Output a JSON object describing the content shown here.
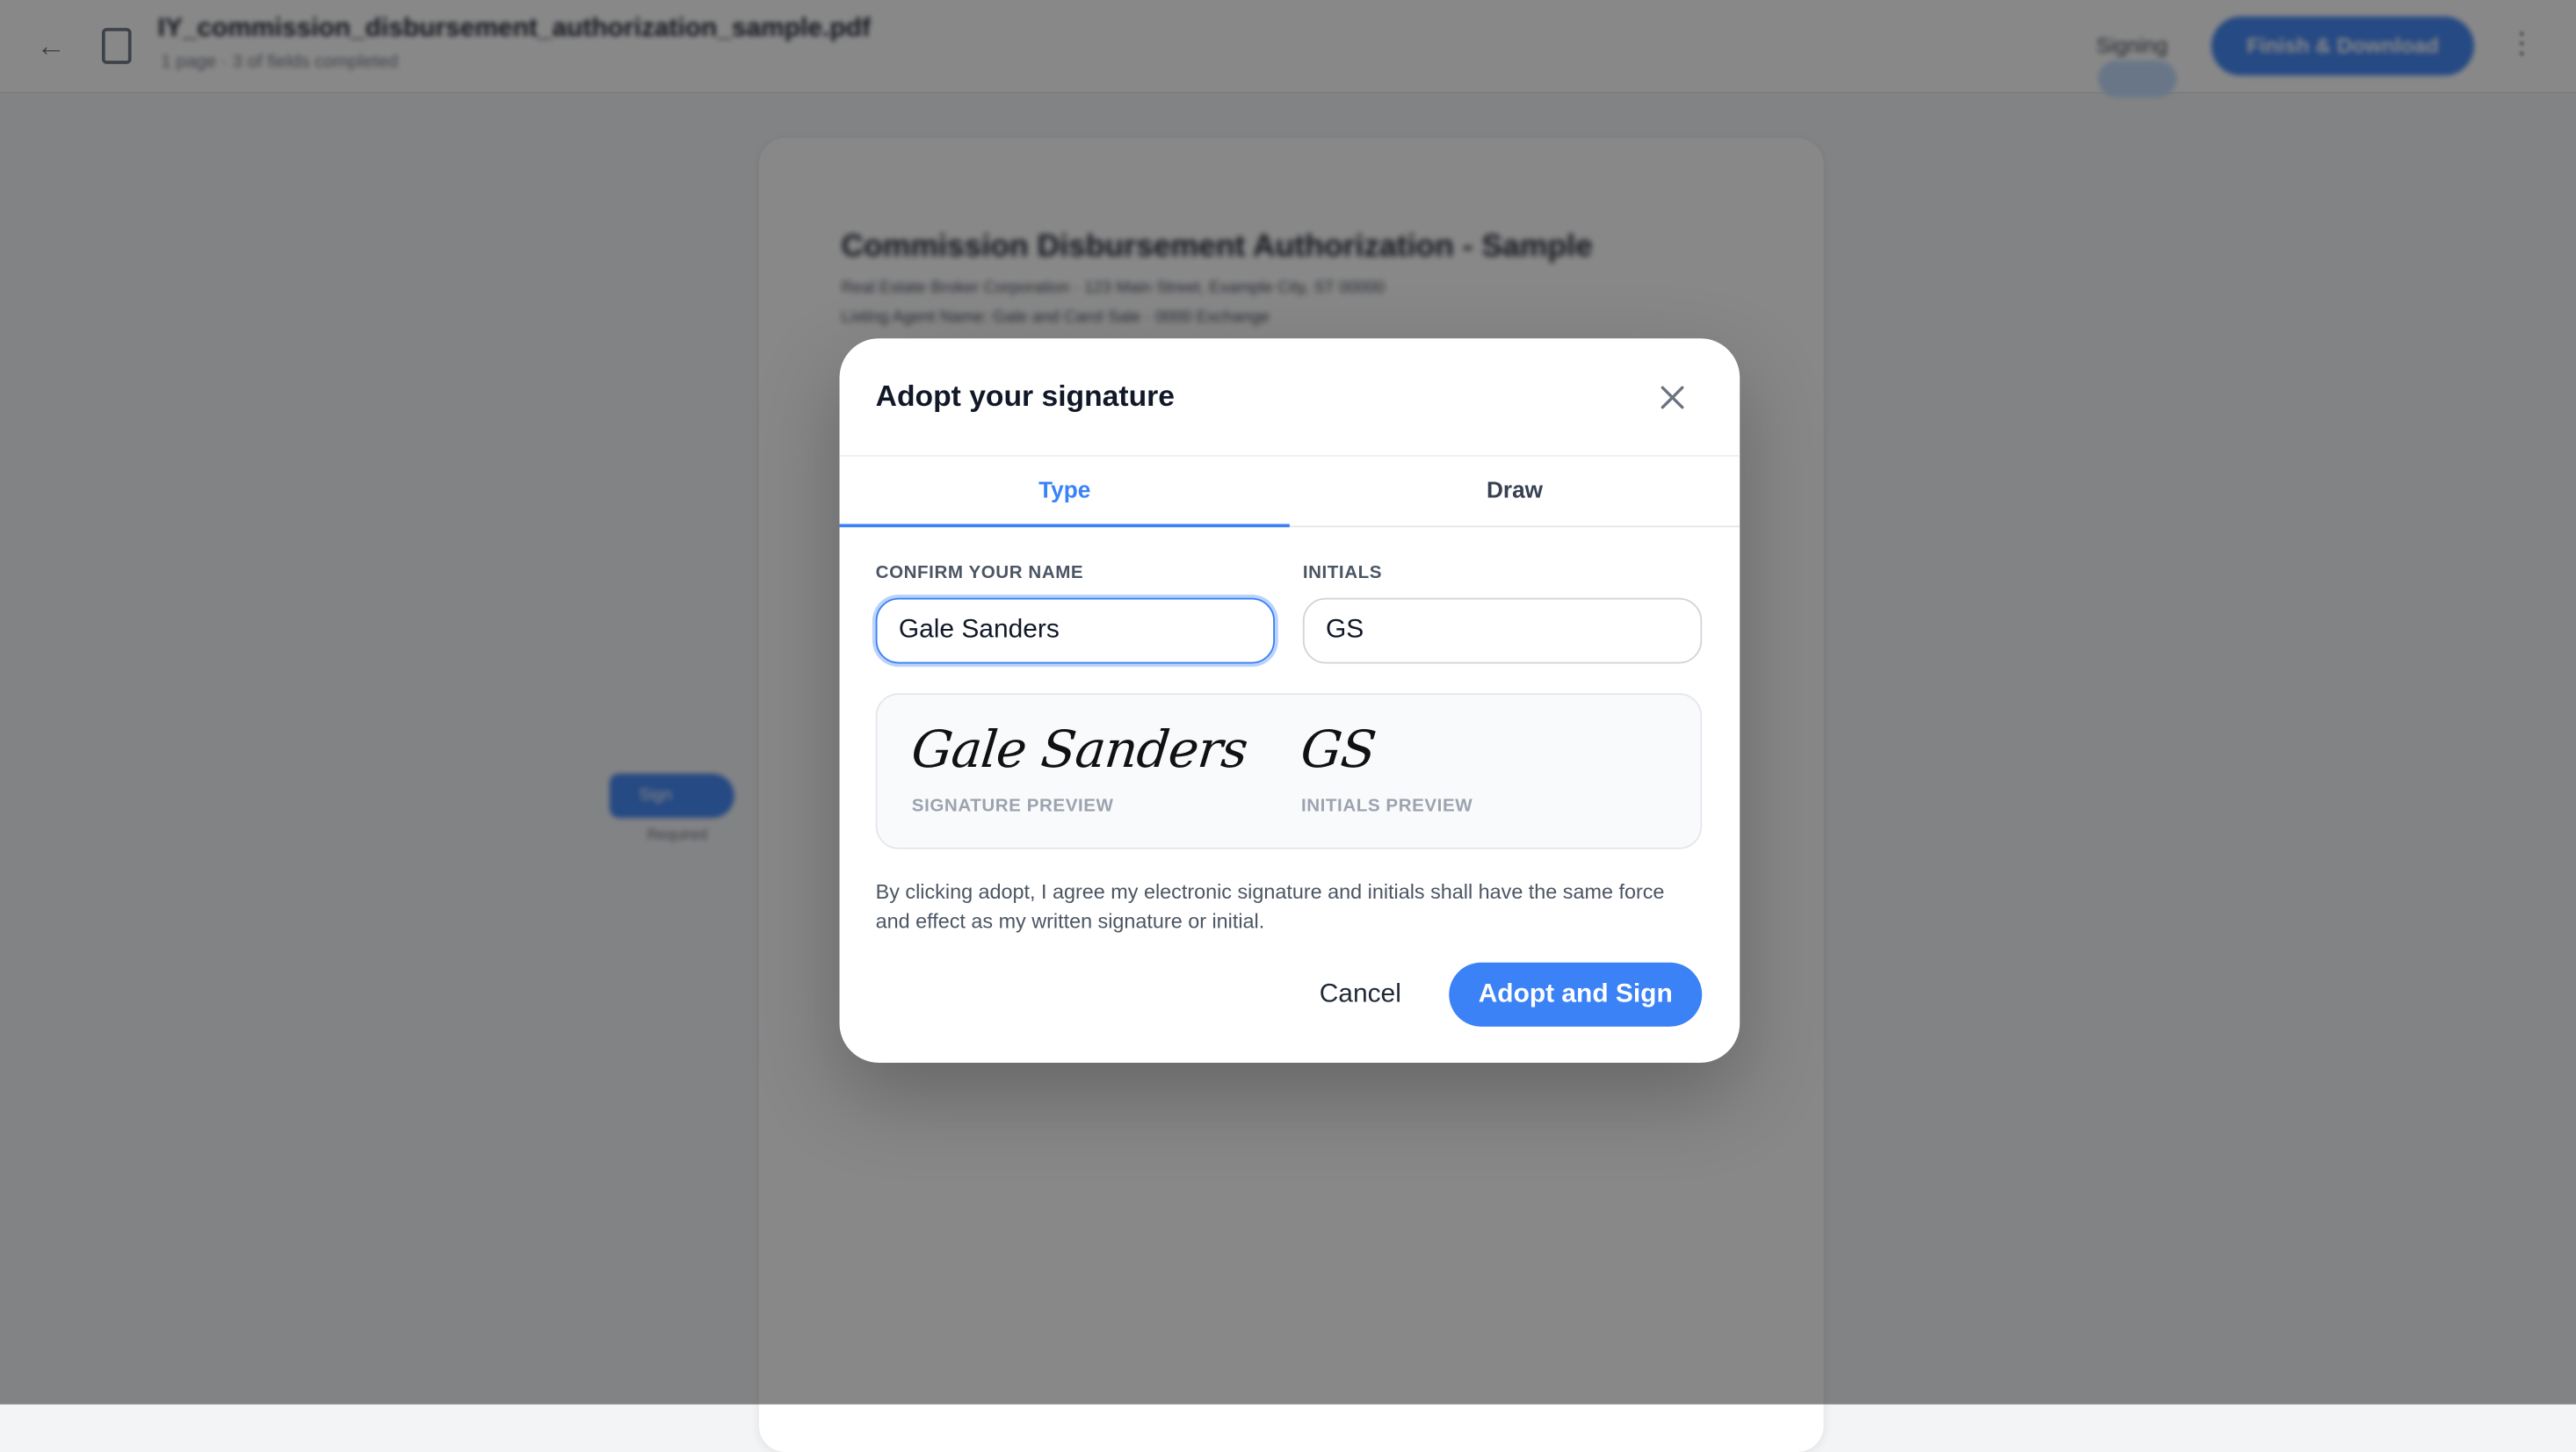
{
  "app": {
    "document_title": "IY_commission_disbursement_authorization_sample.pdf",
    "document_subtitle": "1 page · 3 of fields completed",
    "mode_label": "Signing",
    "finish_label": "Finish & Download",
    "back_icon": "arrow-left-icon",
    "doc_icon": "document-icon",
    "more_icon": "more-icon"
  },
  "document": {
    "title": "Commission Disbursement Authorization - Sample",
    "lines": [
      "Real Estate Broker Corporation · 123 Main Street, Example City, ST 00000",
      "Listing Agent Name: Gale and Carol Sale · 0000 Exchange"
    ],
    "sign_tag_label": "Sign",
    "sign_tag_sub": "Required"
  },
  "modal": {
    "title": "Adopt your signature",
    "close_icon": "close-icon",
    "tabs": [
      {
        "label": "Type",
        "active": true
      },
      {
        "label": "Draw",
        "active": false
      }
    ],
    "name_label": "CONFIRM YOUR NAME",
    "name_value": "Gale Sanders",
    "initials_label": "INITIALS",
    "initials_value": "GS",
    "signature_preview": "Gale Sanders",
    "signature_preview_label": "SIGNATURE PREVIEW",
    "initials_preview": "GS",
    "initials_preview_label": "INITIALS PREVIEW",
    "disclaimer": "By clicking adopt, I agree my electronic signature and initials shall have the same force and effect as my written signature or initial.",
    "cancel_label": "Cancel",
    "adopt_label": "Adopt and Sign"
  },
  "colors": {
    "accent": "#3b82f6",
    "overlay": "rgba(17,17,17,0.5)"
  }
}
